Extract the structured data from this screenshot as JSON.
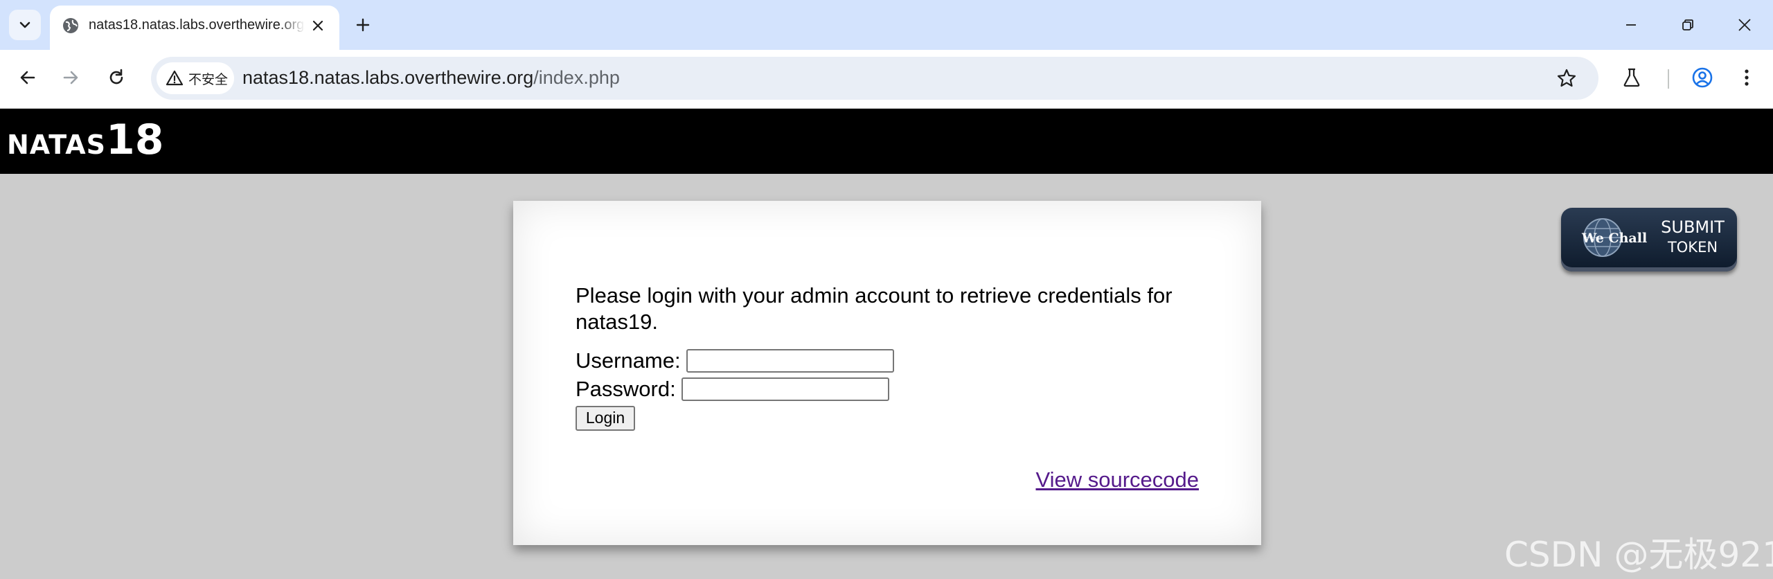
{
  "browser": {
    "tab": {
      "title": "natas18.natas.labs.overthewire.org/index.php"
    },
    "address_bar": {
      "security_label": "不安全",
      "url_host": "natas18.natas.labs.overthewire.org",
      "url_path": "/index.php"
    },
    "icons": {
      "tab_search": "chevron-down-icon",
      "tab_favicon": "globe-icon",
      "tab_close": "close-icon",
      "new_tab": "plus-icon",
      "back": "arrow-left-icon",
      "forward": "arrow-right-icon",
      "reload": "reload-icon",
      "bookmark": "star-icon",
      "labs": "flask-icon",
      "profile": "profile-icon",
      "menu": "kebab-menu-icon",
      "minimize": "minimize-icon",
      "restore": "restore-icon",
      "close_window": "close-icon"
    }
  },
  "page": {
    "header": {
      "title_word": "NATAS",
      "title_number": "18"
    },
    "intro_text": "Please login with your admin account to retrieve credentials for natas19.",
    "form": {
      "username_label": "Username:",
      "username_value": "",
      "password_label": "Password:",
      "password_value": "",
      "submit_label": "Login"
    },
    "source_link": "View sourcecode",
    "wechall": {
      "brand": "We Chall",
      "line1": "SUBMIT",
      "line2": "TOKEN"
    },
    "watermark": "CSDN @无极921"
  },
  "colors": {
    "tabstrip_bg": "#d3e3fd",
    "omnibox_bg": "#e9eef6",
    "page_bg": "#cccccc",
    "header_bg": "#000000",
    "link_visited": "#551a8b",
    "profile_accent": "#1a73e8"
  }
}
